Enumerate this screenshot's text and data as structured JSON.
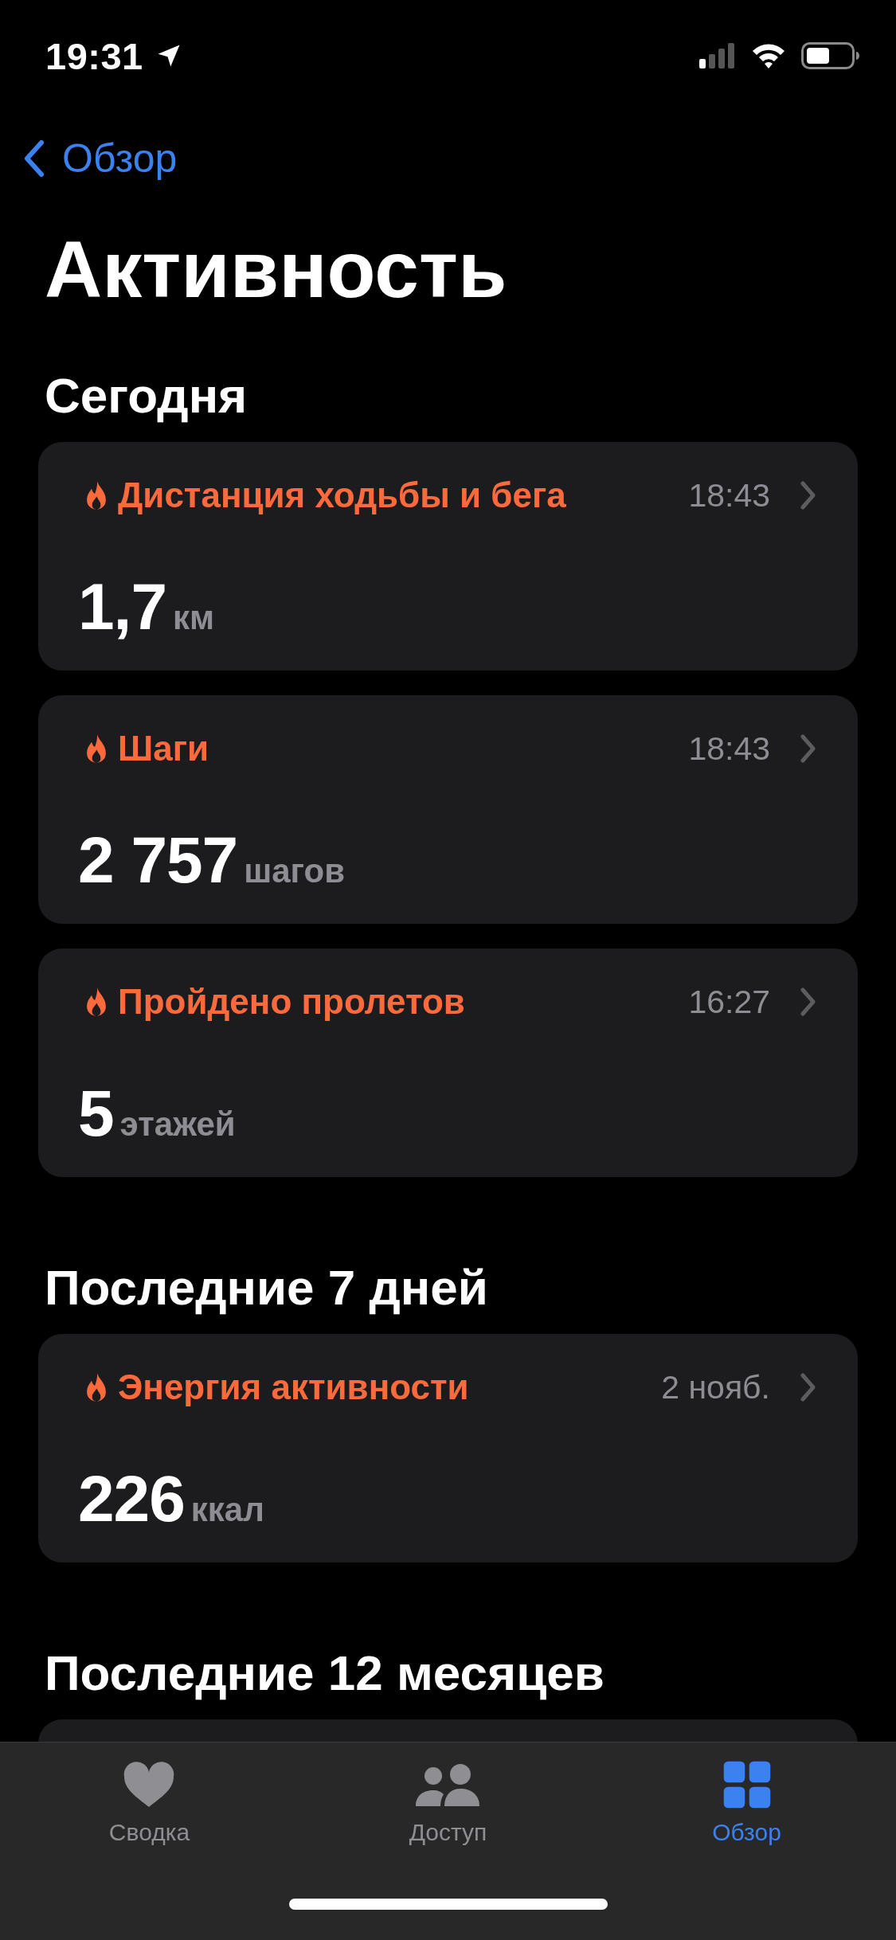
{
  "status_bar": {
    "time": "19:31"
  },
  "nav": {
    "back": "Обзор"
  },
  "title": "Активность",
  "sections": [
    {
      "title": "Сегодня",
      "cards": [
        {
          "kind": "metric",
          "title": "Дистанция ходьбы и бега",
          "time": "18:43",
          "value": "1,7",
          "unit": "км"
        },
        {
          "kind": "metric",
          "title": "Шаги",
          "time": "18:43",
          "value": "2 757",
          "unit": "шагов"
        },
        {
          "kind": "metric",
          "title": "Пройдено пролетов",
          "time": "16:27",
          "value": "5",
          "unit": "этажей"
        }
      ]
    },
    {
      "title": "Последние 7 дней",
      "cards": [
        {
          "kind": "metric",
          "title": "Энергия активности",
          "time": "2 нояб.",
          "value": "226",
          "unit": "ккал"
        }
      ]
    },
    {
      "title": "Последние 12 месяцев",
      "cards": [
        {
          "kind": "clipped"
        }
      ]
    }
  ],
  "tabs": [
    {
      "label": "Сводка",
      "selected": false
    },
    {
      "label": "Доступ",
      "selected": false
    },
    {
      "label": "Обзор",
      "selected": true
    }
  ]
}
